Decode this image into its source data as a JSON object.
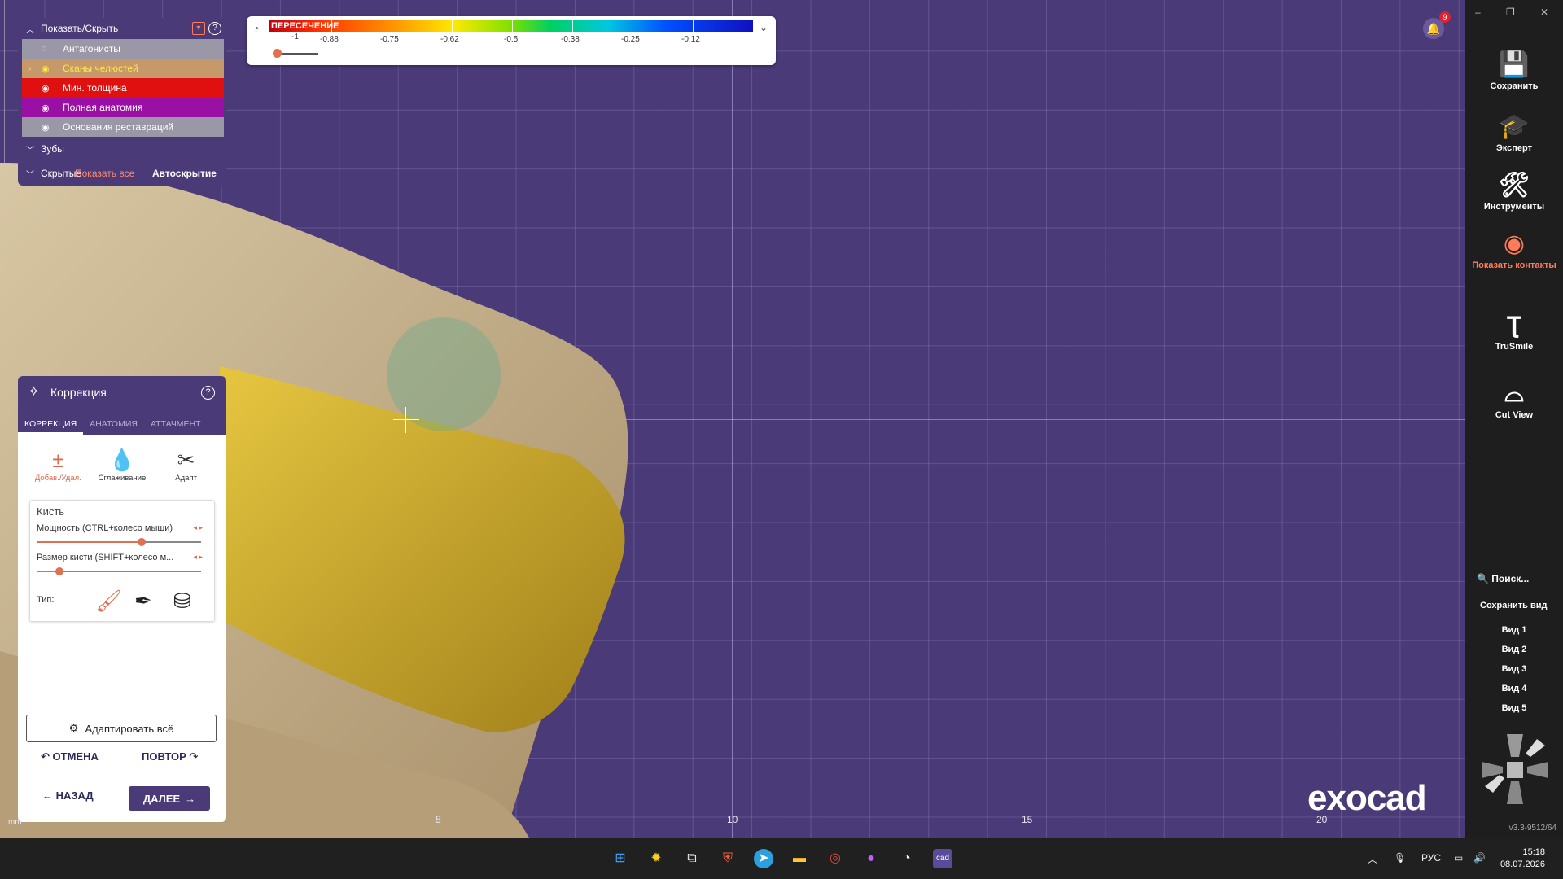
{
  "scale": {
    "title": "ПЕРЕСЕЧЕНИЕ",
    "labels": [
      "-1",
      "-0.88",
      "-0.75",
      "-0.62",
      "-0.5",
      "-0.38",
      "-0.25",
      "-0.12"
    ],
    "slider_value": -1
  },
  "visibility": {
    "header": "Показать/Скрыть",
    "items": [
      {
        "label": "Антагонисты",
        "color": "#9a98a6"
      },
      {
        "label": "Сканы челюстей",
        "color": "#c7986a"
      },
      {
        "label": "Мин. толщина",
        "color": "#e01010"
      },
      {
        "label": "Полная анатомия",
        "color": "#9a0fa4"
      },
      {
        "label": "Основания реставраций",
        "color": "#9a98a6"
      }
    ],
    "teeth": "Зубы",
    "hidden": "Скрытые",
    "show_all": "Показать все",
    "autohide": "Автоскрытие"
  },
  "correction": {
    "title": "Коррекция",
    "tabs": [
      "КОРРЕКЦИЯ",
      "АНАТОМИЯ",
      "АТТАЧМЕНТ"
    ],
    "tools": [
      "Добав./Удал.",
      "Сглаживание",
      "Адапт"
    ],
    "brush_title": "Кисть",
    "power_label": "Мощность (CTRL+колесо мыши)",
    "power_value": 0.64,
    "size_label": "Размер кисти (SHIFT+колесо м...",
    "size_value": 0.14,
    "type_label": "Тип:",
    "adapt_all": "Адаптировать всё",
    "undo": "ОТМЕНА",
    "redo": "ПОВТОР",
    "back": "НАЗАД",
    "next": "ДАЛЕЕ"
  },
  "sidebar": {
    "items": [
      {
        "label": "Сохранить",
        "icon": "save-icon"
      },
      {
        "label": "Эксперт",
        "icon": "graduation-cap-icon"
      },
      {
        "label": "Инструменты",
        "icon": "tools-icon"
      },
      {
        "label": "Показать контакты",
        "icon": "contacts-icon"
      },
      {
        "label": "TruSmile",
        "icon": "trusmile-icon"
      },
      {
        "label": "Cut View",
        "icon": "tooth-icon"
      }
    ],
    "search": "Поиск...",
    "save_view": "Сохранить вид",
    "views": [
      "Вид 1",
      "Вид 2",
      "Вид 3",
      "Вид 4",
      "Вид 5"
    ],
    "version": "v3.3-9512/64"
  },
  "viewport": {
    "axis_ticks": [
      "5",
      "10",
      "15",
      "20"
    ],
    "unit": "mm",
    "logo": "exocad",
    "notifications": "9"
  },
  "taskbar": {
    "lang": "РУС",
    "time": "15:18",
    "date": "08.07.2026"
  },
  "colors": {
    "accent": "#ff7b5a",
    "panel": "#4a3a78",
    "tooth": "#c7a97e",
    "gold": "#d6b22a"
  }
}
